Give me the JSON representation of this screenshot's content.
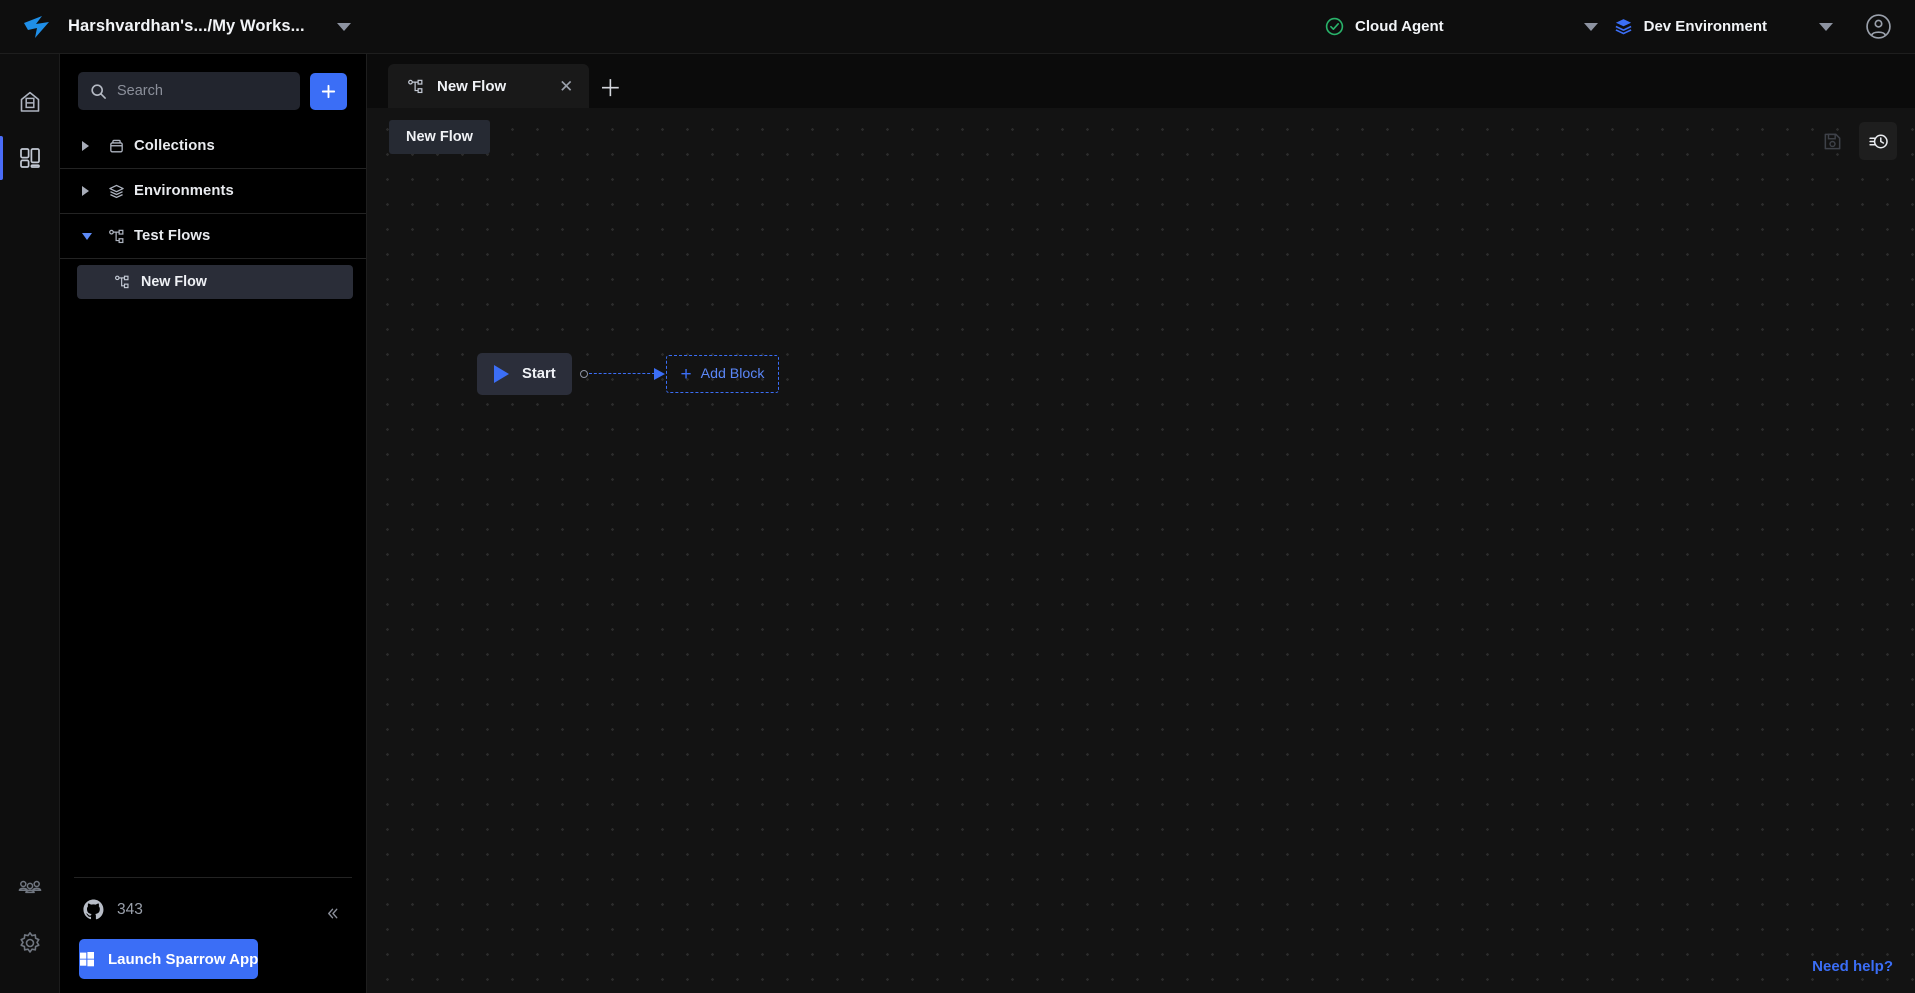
{
  "topbar": {
    "logo_icon": "sparrow-bird-logo",
    "workspace": "Harshvardhan's.../My Works...",
    "workspace_caret_icon": "chevron-down-icon",
    "agent": {
      "status_icon": "check-circle-icon",
      "label": "Cloud Agent",
      "caret_icon": "chevron-down-icon"
    },
    "environment": {
      "icon": "layers-icon",
      "label": "Dev Environment",
      "caret_icon": "chevron-down-icon"
    },
    "account_icon": "user-circle-icon"
  },
  "rail": {
    "items": [
      {
        "icon": "home-icon",
        "name": "home",
        "active": false
      },
      {
        "icon": "dashboard-grid-icon",
        "name": "workspace",
        "active": true
      }
    ],
    "bottom_items": [
      {
        "icon": "people-icon",
        "name": "team"
      },
      {
        "icon": "gear-icon",
        "name": "settings"
      }
    ]
  },
  "sidebar": {
    "search": {
      "placeholder": "Search",
      "value": "",
      "icon": "search-icon"
    },
    "add_button": {
      "icon": "plus-icon",
      "label": "+"
    },
    "tree": [
      {
        "label": "Collections",
        "icon": "collection-icon",
        "expanded": false,
        "caret": "triangle-right"
      },
      {
        "label": "Environments",
        "icon": "layers-icon",
        "expanded": false,
        "caret": "triangle-right"
      },
      {
        "label": "Test Flows",
        "icon": "flow-icon",
        "expanded": true,
        "caret": "triangle-down"
      }
    ],
    "children": [
      {
        "label": "New Flow",
        "icon": "flow-icon",
        "selected": true
      }
    ],
    "footer": {
      "github_icon": "github-icon",
      "github_stars": "343",
      "collapse_icon": "chevrons-left-icon",
      "launch_button": {
        "icon": "windows-icon",
        "label": "Launch Sparrow App"
      }
    }
  },
  "main": {
    "tabs": [
      {
        "label": "New Flow",
        "icon": "flow-icon",
        "close_icon": "close-icon",
        "active": true
      }
    ],
    "new_tab_button": {
      "icon": "plus-icon",
      "label": "+"
    },
    "canvas": {
      "flow_name_chip": "New Flow",
      "tools": [
        {
          "name": "save",
          "icon": "save-disk-icon",
          "enabled": false
        },
        {
          "name": "history",
          "icon": "history-clock-icon",
          "enabled": true
        }
      ],
      "nodes": [
        {
          "type": "start",
          "label": "Start",
          "icon": "play-icon"
        },
        {
          "type": "placeholder",
          "label": "Add Block",
          "icon": "plus-icon"
        }
      ],
      "need_help": "Need help?"
    }
  },
  "colors": {
    "accent": "#3b6ef6",
    "canvas_bg": "#131313",
    "panel_bg": "#000000",
    "node_bg": "#2b2e3a",
    "status_green": "#29b36a"
  }
}
